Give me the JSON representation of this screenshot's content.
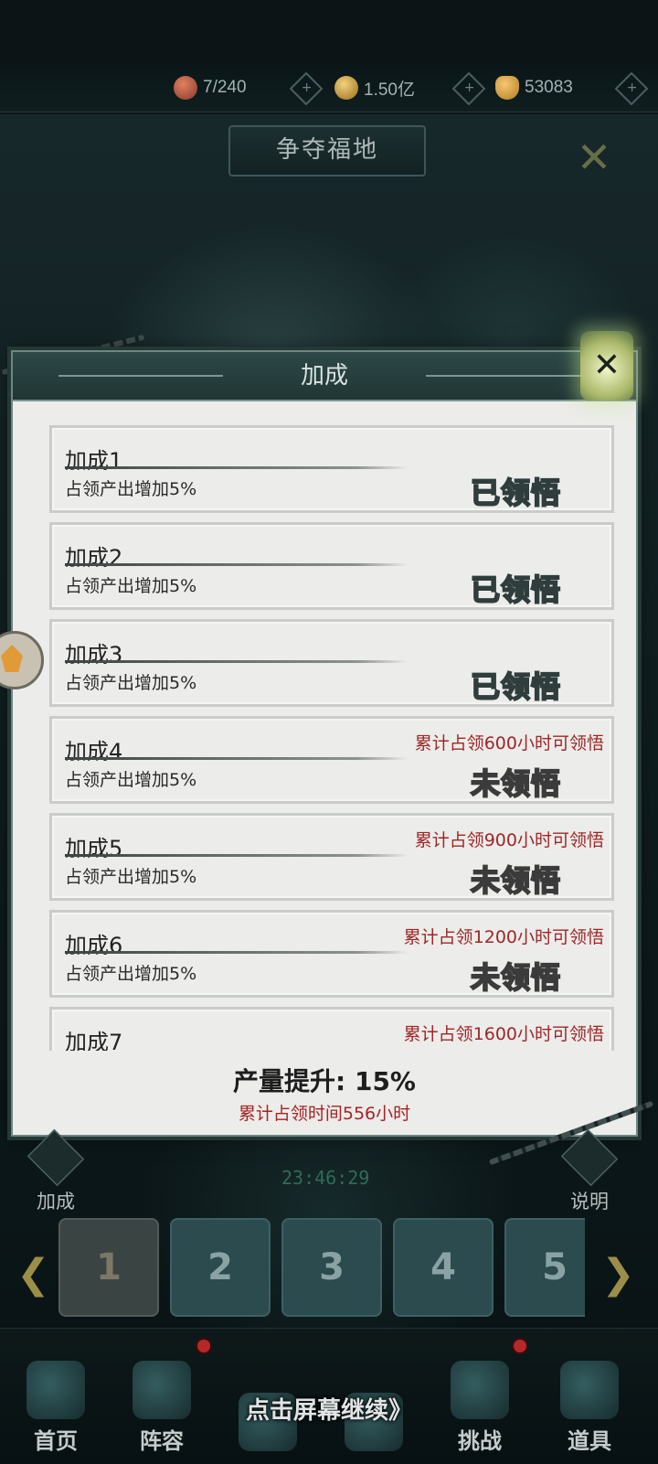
{
  "resources": [
    {
      "icon": "gourd-icon",
      "value": "7/240"
    },
    {
      "icon": "coin-icon",
      "value": "1.50亿"
    },
    {
      "icon": "heart-icon",
      "value": "53083"
    }
  ],
  "scene": {
    "title": "争夺福地"
  },
  "modal": {
    "title": "加成",
    "close_icon": "close-icon",
    "cards": [
      {
        "name": "加成1",
        "desc": "占领产出增加5%",
        "req": "",
        "status": "已领悟",
        "unlocked": true
      },
      {
        "name": "加成2",
        "desc": "占领产出增加5%",
        "req": "",
        "status": "已领悟",
        "unlocked": true
      },
      {
        "name": "加成3",
        "desc": "占领产出增加5%",
        "req": "",
        "status": "已领悟",
        "unlocked": true
      },
      {
        "name": "加成4",
        "desc": "占领产出增加5%",
        "req": "累计占领600小时可领悟",
        "status": "未领悟",
        "unlocked": false
      },
      {
        "name": "加成5",
        "desc": "占领产出增加5%",
        "req": "累计占领900小时可领悟",
        "status": "未领悟",
        "unlocked": false
      },
      {
        "name": "加成6",
        "desc": "占领产出增加5%",
        "req": "累计占领1200小时可领悟",
        "status": "未领悟",
        "unlocked": false
      },
      {
        "name": "加成7",
        "desc": "",
        "req": "累计占领1600小时可领悟",
        "status": "",
        "unlocked": false
      }
    ],
    "summary": {
      "boost": "产量提升: 15%",
      "time": "累计占领时间556小时"
    }
  },
  "side": {
    "left_label": "加成",
    "right_label": "说明"
  },
  "timer": "23:46:29",
  "pages": [
    "1",
    "2",
    "3",
    "4",
    "5"
  ],
  "nav": [
    {
      "label": "首页"
    },
    {
      "label": "阵容"
    },
    {
      "label": ""
    },
    {
      "label": ""
    },
    {
      "label": "挑战"
    },
    {
      "label": "道具"
    }
  ],
  "continue_hint": "点击屏幕继续》"
}
